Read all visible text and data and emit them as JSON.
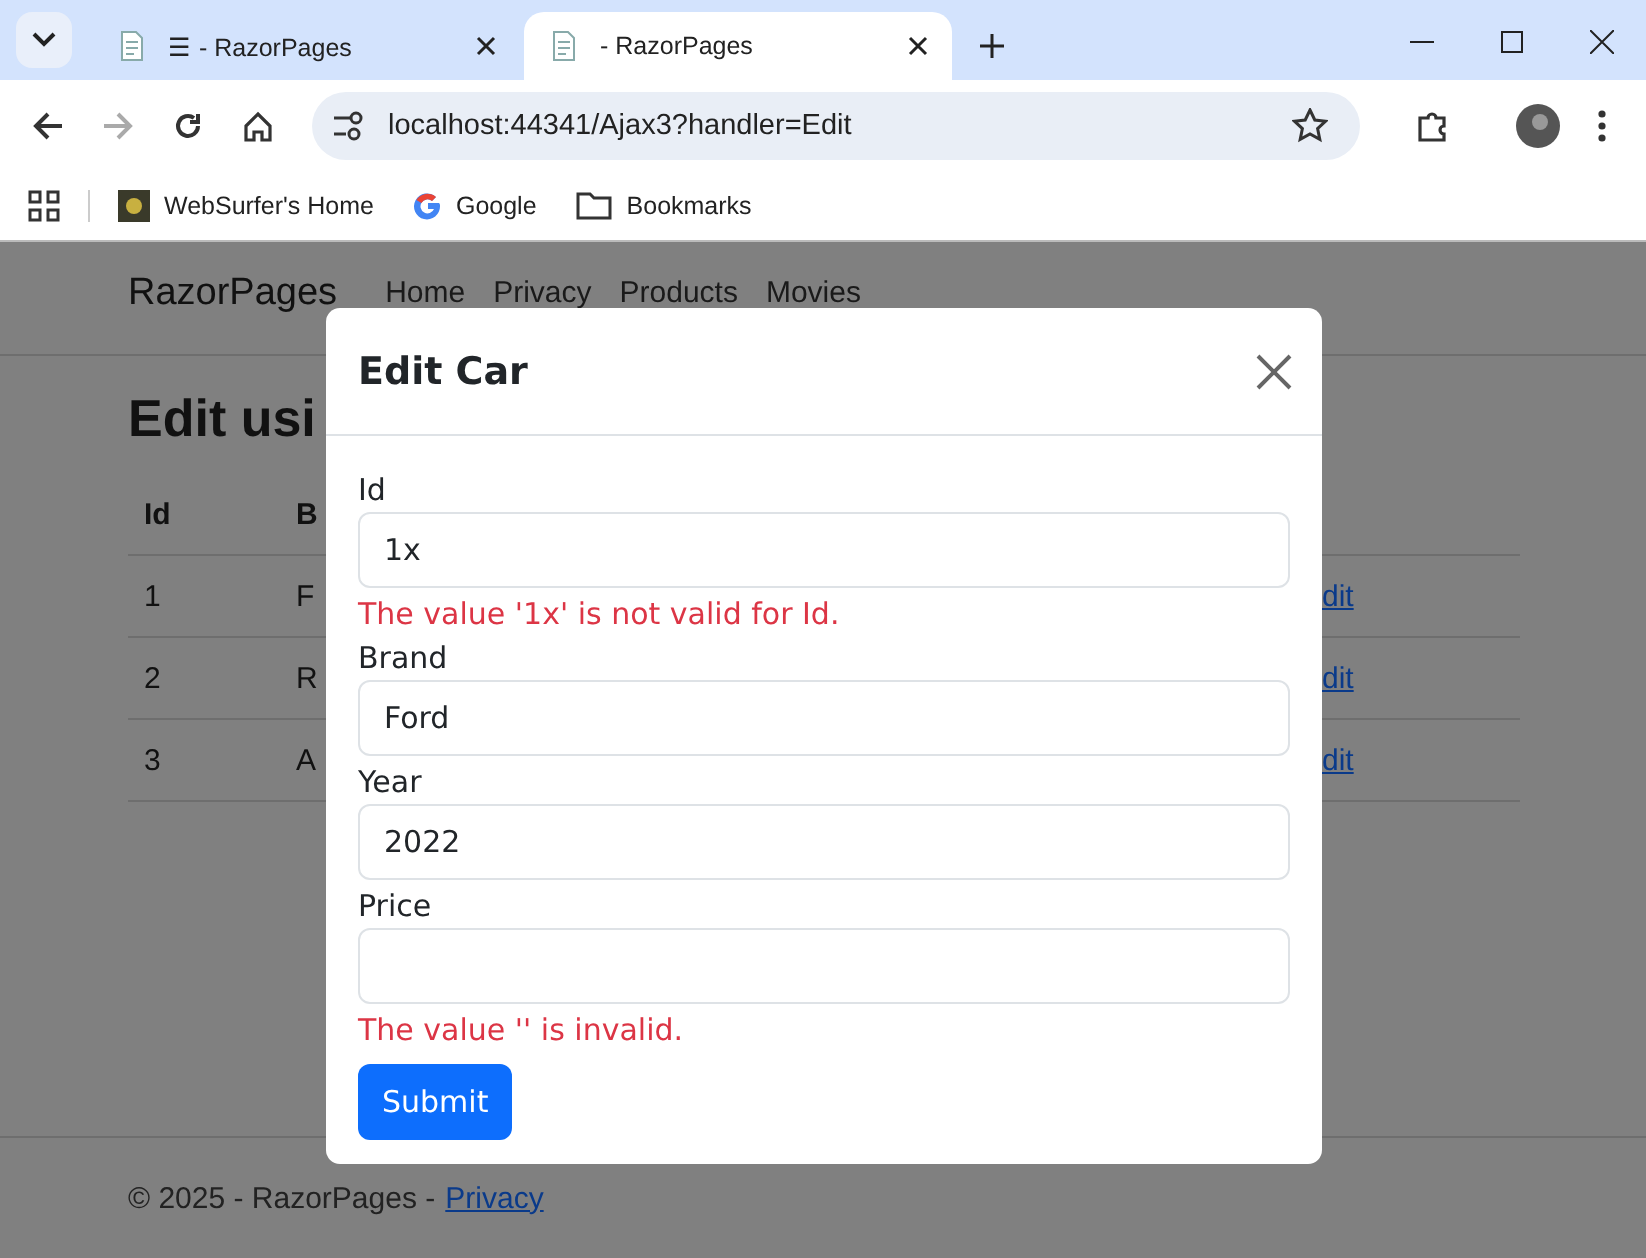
{
  "browser": {
    "tabs": [
      {
        "title": "☰ - RazorPages",
        "selected": false
      },
      {
        "title": "- RazorPages",
        "selected": true
      }
    ],
    "address": "localhost:44341/Ajax3?handler=Edit",
    "bookmarks": [
      {
        "label": "WebSurfer's Home",
        "kind": "photo"
      },
      {
        "label": "Google",
        "kind": "google"
      },
      {
        "label": "Bookmarks",
        "kind": "folder"
      }
    ]
  },
  "page": {
    "brand": "RazorPages",
    "nav": [
      "Home",
      "Privacy",
      "Products",
      "Movies"
    ],
    "heading": "Edit usi",
    "table": {
      "columns": [
        "Id",
        "B"
      ],
      "rows": [
        [
          "1",
          "F",
          "dit"
        ],
        [
          "2",
          "R",
          "dit"
        ],
        [
          "3",
          "A",
          "dit"
        ]
      ]
    },
    "footer": {
      "text": "© 2025 - RazorPages -",
      "link": "Privacy"
    }
  },
  "modal": {
    "title": "Edit Car",
    "fields": [
      {
        "label": "Id",
        "value": "1x",
        "error": "The value '1x' is not valid for Id."
      },
      {
        "label": "Brand",
        "value": "Ford"
      },
      {
        "label": "Year",
        "value": "2022"
      },
      {
        "label": "Price",
        "error": "The value '' is invalid."
      }
    ],
    "button": "Submit"
  }
}
